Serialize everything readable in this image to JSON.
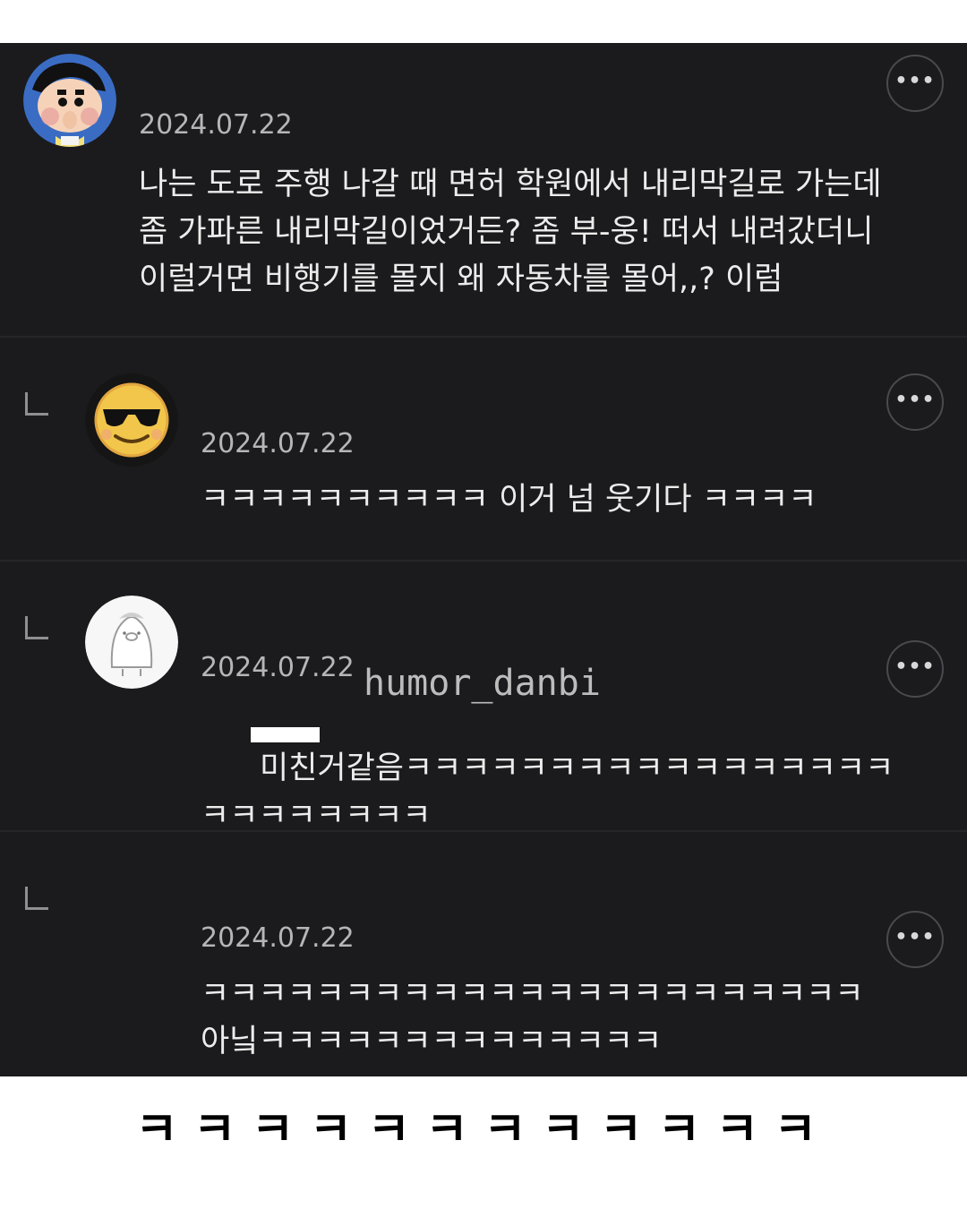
{
  "comments": [
    {
      "date": "2024.07.22",
      "avatar": "shinchan-avatar",
      "lines": [
        "나는 도로 주행 나갈 때 면허 학원에서 내리막길로 가는데",
        "좀 가파른 내리막길이었거든? 좀 부-웅! 떠서 내려갔더니",
        "이럴거면 비행기를 몰지 왜 자동차를 몰어,,? 이럼"
      ],
      "more_label": "•••"
    },
    {
      "date": "2024.07.22",
      "avatar": "sunglasses-emoji-avatar",
      "lines": [
        "ㅋㅋㅋㅋㅋㅋㅋㅋㅋㅋ 이거 넘 웃기다 ㅋㅋㅋㅋ"
      ],
      "more_label": "•••"
    },
    {
      "date": "2024.07.22",
      "avatar": "penguin-avatar",
      "lines": [
        "미친거같음ㅋㅋㅋㅋㅋㅋㅋㅋㅋㅋㅋㅋㅋㅋㅋㅋㅋ",
        "ㅋㅋㅋㅋㅋㅋㅋㅋ"
      ],
      "more_label": "•••"
    },
    {
      "date": "2024.07.22",
      "avatar": "",
      "lines": [
        "ㅋㅋㅋㅋㅋㅋㅋㅋㅋㅋㅋㅋㅋㅋㅋㅋㅋㅋㅋㅋㅋㅋㅋ",
        "아닠ㅋㅋㅋㅋㅋㅋㅋㅋㅋㅋㅋㅋㅋㅋ"
      ],
      "more_label": "•••"
    }
  ],
  "watermark": "humor_danbi",
  "footer_caption": "ㅋㅋㅋㅋㅋㅋㅋㅋㅋㅋㅋㅋ"
}
